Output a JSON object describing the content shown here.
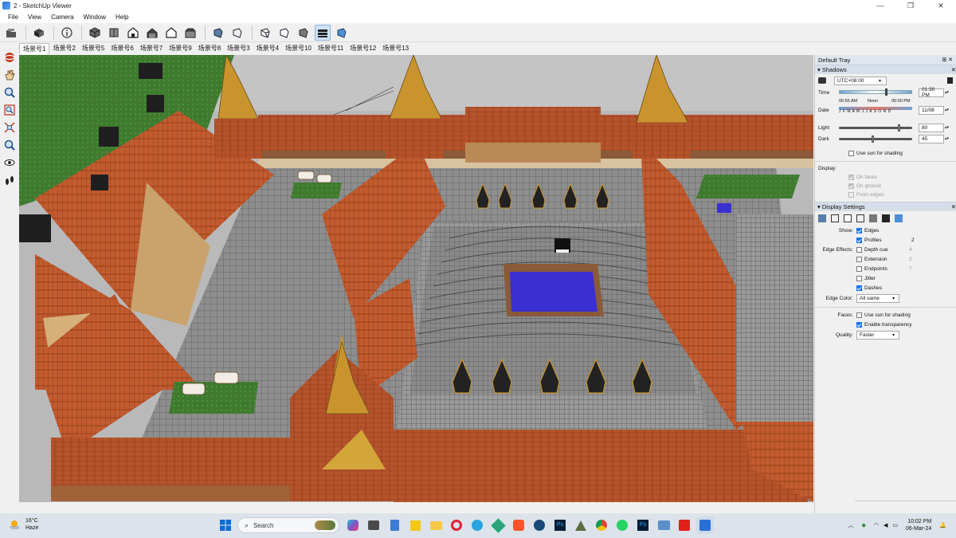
{
  "window": {
    "title": "2 - SketchUp Viewer",
    "minimize": "—",
    "maximize": "❐",
    "close": "✕"
  },
  "menu": [
    "File",
    "View",
    "Camera",
    "Window",
    "Help"
  ],
  "toolbar": {
    "icons": [
      "open-file-icon",
      "component-icon",
      "model-info-icon",
      "iso-view-icon",
      "top-view-icon",
      "front-view-icon",
      "right-view-icon",
      "back-view-icon",
      "left-view-icon",
      "xray-style-icon",
      "wireframe-style-icon",
      "hidden-line-style-icon",
      "shaded-style-icon",
      "shaded-textures-style-icon",
      "monochrome-style-icon"
    ]
  },
  "scenes": [
    "场景号1",
    "场景号2",
    "场景号5",
    "场景号6",
    "场景号7",
    "场景号9",
    "场景号8",
    "场景号3",
    "场景号4",
    "场景号10",
    "场景号11",
    "场景号12",
    "场景号13"
  ],
  "left_tools": [
    "orbit-icon",
    "pan-icon",
    "zoom-icon",
    "zoom-window-icon",
    "zoom-extents-icon",
    "previous-view-icon",
    "look-around-icon",
    "walk-icon"
  ],
  "tray": {
    "title": "Default Tray",
    "shadows": {
      "header": "Shadows",
      "timezone": "UTC+08:00",
      "time_label": "Time",
      "time_start": "06:55 AM",
      "time_noon": "Noon",
      "time_end": "05:00 PM",
      "time_value": "01:30 PM",
      "date_label": "Date",
      "months": "J F M A M J J A S O N D",
      "date_value": "11/08",
      "light_label": "Light",
      "light_value": "80",
      "light_fraction": 0.8,
      "dark_label": "Dark",
      "dark_value": "45",
      "dark_fraction": 0.45,
      "use_sun": "Use sun for shading",
      "display_label": "Display:",
      "on_faces": "On faces",
      "on_ground": "On ground",
      "from_edges": "From edges"
    },
    "display": {
      "header": "Display Settings",
      "show_label": "Show:",
      "edges": "Edges",
      "profiles": "Profiles",
      "profiles_value": "2",
      "edge_effects_label": "Edge Effects:",
      "depth_cue": "Depth cue",
      "depth_cue_value": "4",
      "extension": "Extension",
      "extension_value": "2",
      "endpoints": "Endpoints",
      "endpoints_value": "7",
      "jitter": "Jitter",
      "dashes": "Dashes",
      "edge_color_label": "Edge Color:",
      "edge_color_value": "All same",
      "faces_label": "Faces:",
      "faces_use_sun": "Use sun for shading",
      "enable_transparency": "Enable transparency",
      "quality_label": "Quality:",
      "quality_value": "Faster"
    }
  },
  "taskbar": {
    "weather_temp": "16°C",
    "weather_desc": "Haze",
    "search": "Search",
    "time": "10:02 PM",
    "date": "06-Mar-24",
    "apps": [
      "start-icon",
      "search",
      "widgets-icon",
      "copilot-icon",
      "files-icon",
      "notepad-icon",
      "sticky-notes-icon",
      "explorer-icon",
      "opera-icon",
      "telegram-icon",
      "anydesk-icon",
      "brave-icon",
      "steam-icon",
      "photoshop-icon",
      "autocad-icon",
      "chrome-icon",
      "whatsapp-icon",
      "photoshop-icon-2",
      "photo-viewer-icon",
      "acrobat-icon",
      "sketchup-viewer-icon"
    ]
  },
  "colors": {
    "accent": "#1a73e8",
    "roof": "#b5532b",
    "pool": "#3a2fd1",
    "lawn": "#3f7a2f",
    "paving": "#8e8e8e"
  }
}
